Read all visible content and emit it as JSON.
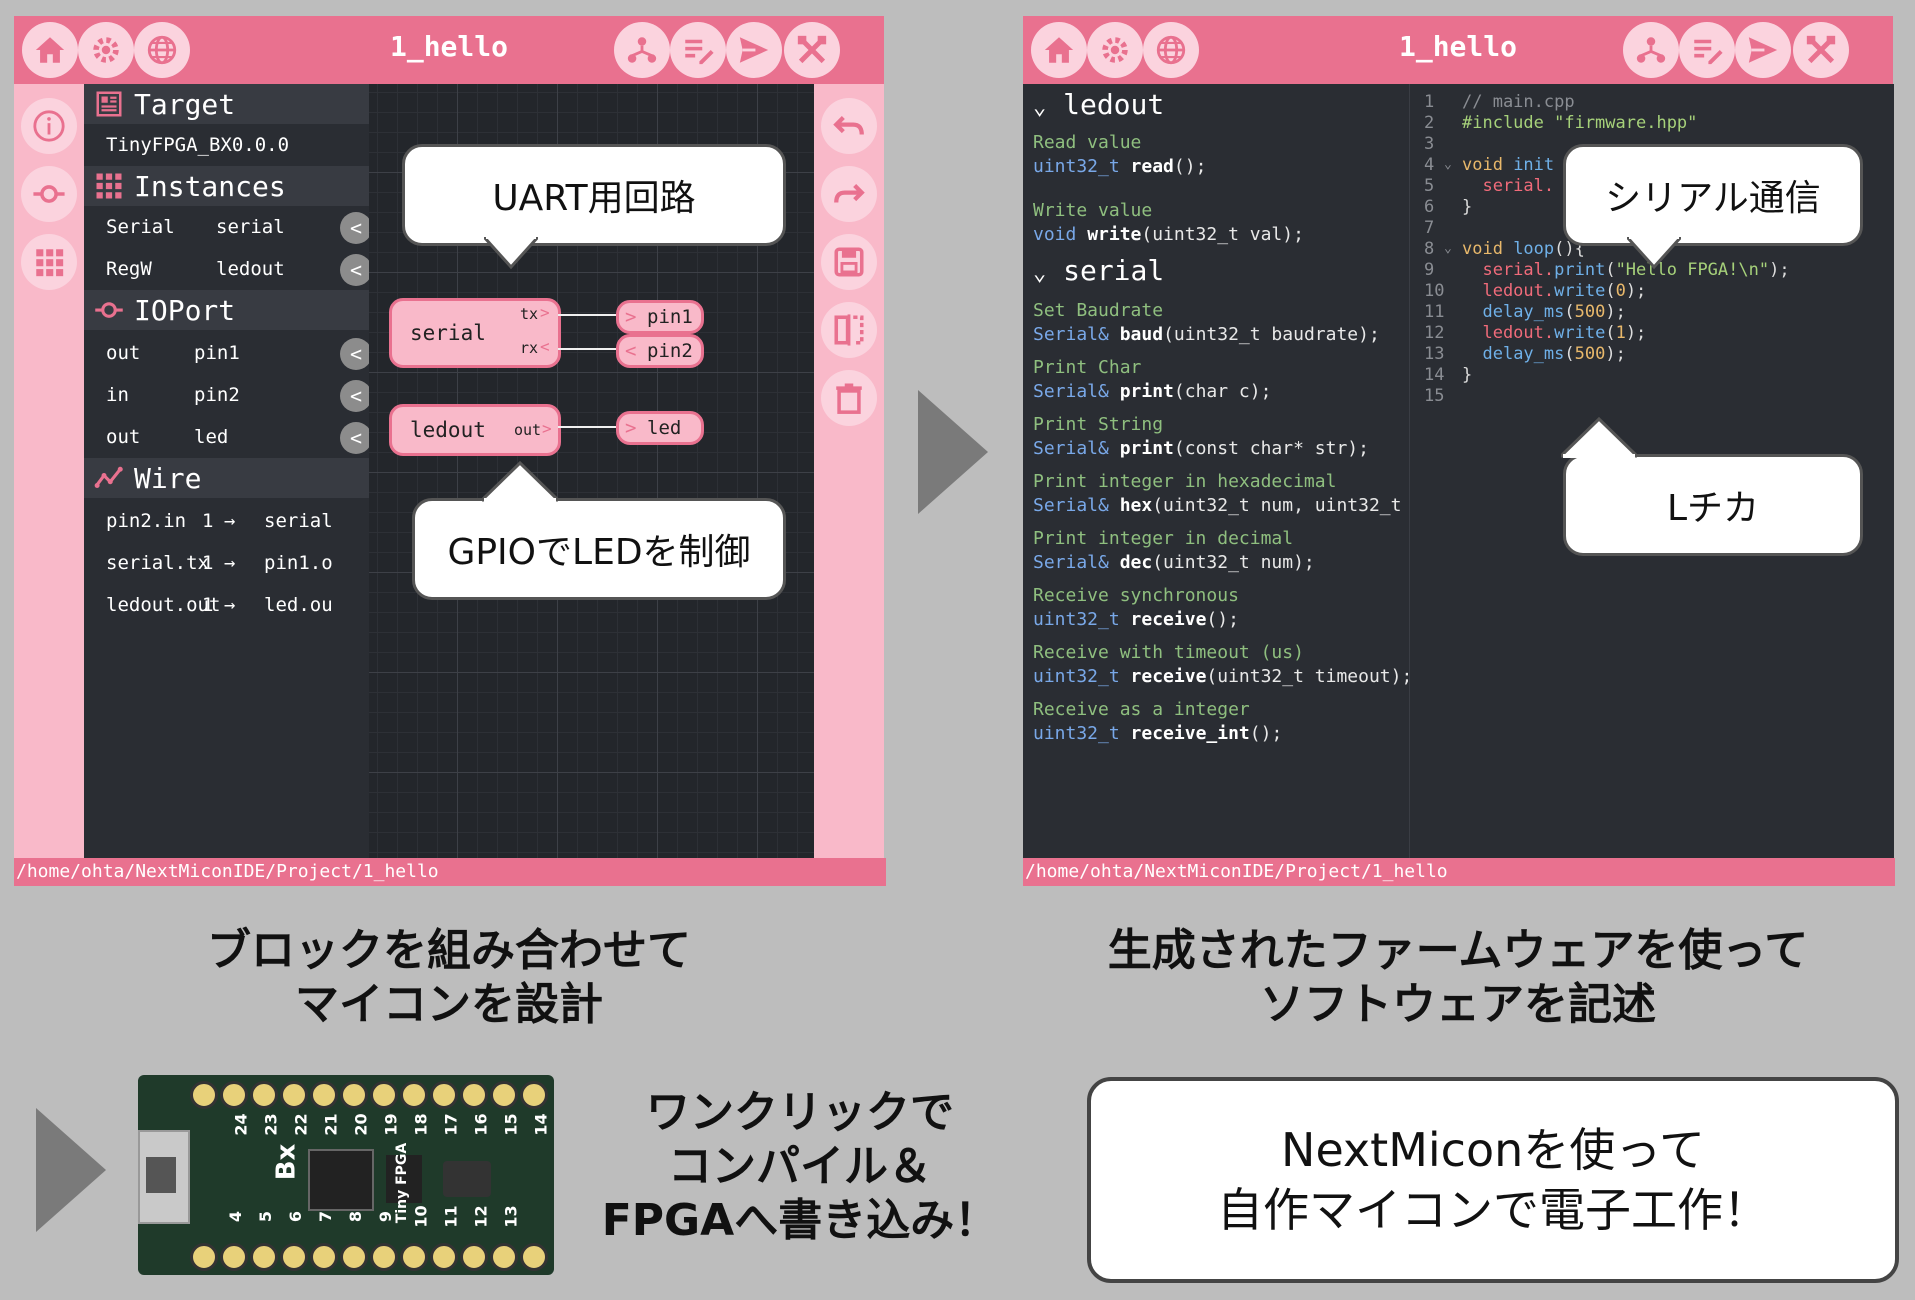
{
  "left_window": {
    "title": "1_hello",
    "status_path": "/home/ohta/NextMiconIDE/Project/1_hello",
    "sections": {
      "target": "Target",
      "instances": "Instances",
      "ioport": "IOPort",
      "wire": "Wire"
    },
    "target_value": "TinyFPGA_BX0.0.0",
    "instances": [
      {
        "type": "Serial",
        "name": "serial"
      },
      {
        "type": "RegW",
        "name": "ledout"
      }
    ],
    "ioports": [
      {
        "dir": "out",
        "name": "pin1"
      },
      {
        "dir": "in",
        "name": "pin2"
      },
      {
        "dir": "out",
        "name": "led"
      }
    ],
    "wires": [
      {
        "from": "pin2.in",
        "width": "1",
        "arrow": "→",
        "to": "serial"
      },
      {
        "from": "serial.tx",
        "width": "1",
        "arrow": "→",
        "to": "pin1.o"
      },
      {
        "from": "ledout.out",
        "width": "1",
        "arrow": "→",
        "to": "led.ou"
      }
    ],
    "canvas": {
      "serial_block": {
        "name": "serial",
        "tx": "tx",
        "rx": "rx"
      },
      "ledout_block": {
        "name": "ledout",
        "out": "out"
      },
      "pins": [
        "pin1",
        "pin2",
        "led"
      ],
      "callout_top": "UART用回路",
      "callout_bottom": "GPIOでLEDを制御"
    },
    "chevron": "<",
    "pin_arrow": ">"
  },
  "right_window": {
    "title": "1_hello",
    "status_path": "/home/ohta/NextMiconIDE/Project/1_hello",
    "api": {
      "ledout_head": "ledout",
      "ledout_items": [
        {
          "desc": "Read value",
          "type": "uint32_t ",
          "fn": "read",
          "args": "();"
        },
        {
          "desc": "Write value",
          "type": "void ",
          "fn": "write",
          "args": "(uint32_t val);"
        }
      ],
      "serial_head": "serial",
      "serial_items": [
        {
          "desc": "Set Baudrate",
          "type": "Serial& ",
          "fn": "baud",
          "args": "(uint32_t baudrate);"
        },
        {
          "desc": "Print Char",
          "type": "Serial& ",
          "fn": "print",
          "args": "(char c);"
        },
        {
          "desc": "Print String",
          "type": "Serial& ",
          "fn": "print",
          "args": "(const char* str);"
        },
        {
          "desc": "Print integer in hexadecimal",
          "type": "Serial& ",
          "fn": "hex",
          "args": "(uint32_t num, uint32_t"
        },
        {
          "desc": "Print integer in decimal",
          "type": "Serial& ",
          "fn": "dec",
          "args": "(uint32_t num);"
        },
        {
          "desc": "Receive synchronous",
          "type": "uint32_t ",
          "fn": "receive",
          "args": "();"
        },
        {
          "desc": "Receive with timeout (us)",
          "type": "uint32_t ",
          "fn": "receive",
          "args": "(uint32_t timeout);"
        },
        {
          "desc": "Receive as a integer",
          "type": "uint32_t ",
          "fn": "receive_int",
          "args": "();"
        }
      ]
    },
    "code": {
      "line_numbers": [
        "1",
        "2",
        "3",
        "4",
        "5",
        "6",
        "7",
        "8",
        "9",
        "10",
        "11",
        "12",
        "13",
        "14",
        "15"
      ],
      "l1": "// main.cpp",
      "l2": "#include \"firmware.hpp\"",
      "l4": "void init",
      "l5": "  serial.",
      "l6": "}",
      "l8": "void loop(){",
      "l9": "  serial.print(\"Hello FPGA!\\n\");",
      "l10": "  ledout.write(0);",
      "l11": "  delay_ms(500);",
      "l12": "  ledout.write(1);",
      "l13": "  delay_ms(500);",
      "l14": "}",
      "fold": "⌄"
    },
    "callout_top": "シリアル通信",
    "callout_bottom": "Lチカ"
  },
  "captions": {
    "left": [
      "ブロックを組み合わせて",
      "マイコンを設計"
    ],
    "right": [
      "生成されたファームウェアを使って",
      "ソフトウェアを記述"
    ],
    "compile": [
      "ワンクリックで",
      "コンパイル＆",
      "FPGAへ書き込み！"
    ],
    "final": [
      "NextMiconを使って",
      "自作マイコンで電子工作！"
    ]
  },
  "board_pins_top": [
    "24",
    "23",
    "22",
    "21",
    "20",
    "19",
    "18",
    "17",
    "16",
    "15",
    "14"
  ],
  "board_pins_bottom": [
    "4",
    "5",
    "6",
    "7",
    "8",
    "9",
    "10",
    "11",
    "12",
    "13"
  ],
  "board_label": "Tiny FPGA",
  "board_bx": "Bx",
  "colors": {
    "accent": "#e9718f",
    "sidebar": "#f9b9c9",
    "button": "#fbd3de",
    "panel": "#2a2d33",
    "background": "#bdbdbd"
  }
}
